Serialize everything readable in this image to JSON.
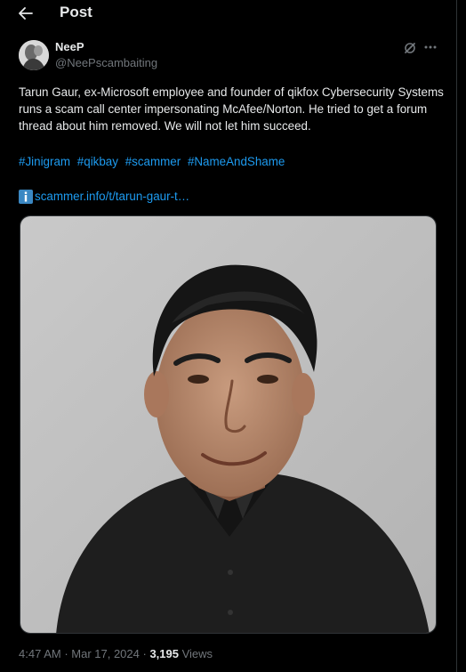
{
  "header": {
    "title": "Post"
  },
  "author": {
    "name": "NeeP",
    "handle": "@NeePscambaiting"
  },
  "post": {
    "text": "Tarun Gaur, ex-Microsoft employee and founder of qikfox Cybersecurity Systems runs a scam call center impersonating McAfee/Norton. He tried to get a forum thread about him removed. We will not let him succeed.",
    "hashtags": [
      "#Jinigram",
      "#qikbay",
      "#scammer",
      "#NameAndShame"
    ],
    "link": "scammer.info/t/tarun-gaur-t…"
  },
  "meta": {
    "time": "4:47 AM",
    "separator1": " · ",
    "date": "Mar 17, 2024",
    "separator2": " · ",
    "views_count": "3,195",
    "views_label": " Views"
  },
  "colors": {
    "background": "#000000",
    "text": "#e7e9ea",
    "muted": "#71767b",
    "link": "#1d9bf0",
    "border": "#2f3336"
  },
  "icons": {
    "back": "arrow-left-icon",
    "grok": "grok-icon",
    "more": "more-horizontal-icon",
    "link_info": "information-icon"
  }
}
